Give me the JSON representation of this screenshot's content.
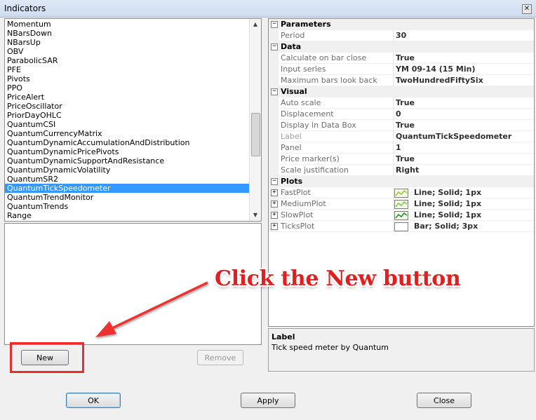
{
  "window": {
    "title": "Indicators",
    "close_glyph": "✕"
  },
  "indicator_list": {
    "items": [
      {
        "label": "Momentum",
        "selected": false
      },
      {
        "label": "NBarsDown",
        "selected": false
      },
      {
        "label": "NBarsUp",
        "selected": false
      },
      {
        "label": "OBV",
        "selected": false
      },
      {
        "label": "ParabolicSAR",
        "selected": false
      },
      {
        "label": "PFE",
        "selected": false
      },
      {
        "label": "Pivots",
        "selected": false
      },
      {
        "label": "PPO",
        "selected": false
      },
      {
        "label": "PriceAlert",
        "selected": false
      },
      {
        "label": "PriceOscillator",
        "selected": false
      },
      {
        "label": "PriorDayOHLC",
        "selected": false
      },
      {
        "label": "QuantumCSI",
        "selected": false
      },
      {
        "label": "QuantumCurrencyMatrix",
        "selected": false
      },
      {
        "label": "QuantumDynamicAccumulationAndDistribution",
        "selected": false
      },
      {
        "label": "QuantumDynamicPricePivots",
        "selected": false
      },
      {
        "label": "QuantumDynamicSupportAndResistance",
        "selected": false
      },
      {
        "label": "QuantumDynamicVolatility",
        "selected": false
      },
      {
        "label": "QuantumSR2",
        "selected": false
      },
      {
        "label": "QuantumTickSpeedometer",
        "selected": true
      },
      {
        "label": "QuantumTrendMonitor",
        "selected": false
      },
      {
        "label": "QuantumTrends",
        "selected": false
      },
      {
        "label": "Range",
        "selected": false
      }
    ],
    "scroll_up_glyph": "▲",
    "scroll_down_glyph": "▼"
  },
  "buttons": {
    "new": "New",
    "remove": "Remove",
    "ok": "OK",
    "apply": "Apply",
    "close": "Close"
  },
  "properties": {
    "rows": [
      {
        "type": "cat",
        "label": "Parameters",
        "expander": "−"
      },
      {
        "type": "prop",
        "name": "Period",
        "value": "30"
      },
      {
        "type": "cat",
        "label": "Data",
        "expander": "−"
      },
      {
        "type": "prop",
        "name": "Calculate on bar close",
        "value": "True"
      },
      {
        "type": "prop",
        "name": "Input series",
        "value": "YM 09-14 (15 Min)"
      },
      {
        "type": "prop",
        "name": "Maximum bars look back",
        "value": "TwoHundredFiftySix"
      },
      {
        "type": "cat",
        "label": "Visual",
        "expander": "−"
      },
      {
        "type": "prop",
        "name": "Auto scale",
        "value": "True"
      },
      {
        "type": "prop",
        "name": "Displacement",
        "value": "0"
      },
      {
        "type": "prop",
        "name": "Display in Data Box",
        "value": "True"
      },
      {
        "type": "prop",
        "name": "Label",
        "value": "QuantumTickSpeedometer",
        "dim": true
      },
      {
        "type": "prop",
        "name": "Panel",
        "value": "1"
      },
      {
        "type": "prop",
        "name": "Price marker(s)",
        "value": "True"
      },
      {
        "type": "prop",
        "name": "Scale justification",
        "value": "Right"
      },
      {
        "type": "cat",
        "label": "Plots",
        "expander": "−"
      },
      {
        "type": "plot",
        "name": "FastPlot",
        "value": "Line; Solid; 1px",
        "expander": "+",
        "swatch": "line",
        "color": "#9acd32"
      },
      {
        "type": "plot",
        "name": "MediumPlot",
        "value": "Line; Solid; 1px",
        "expander": "+",
        "swatch": "line",
        "color": "#7ec850"
      },
      {
        "type": "plot",
        "name": "SlowPlot",
        "value": "Line; Solid; 1px",
        "expander": "+",
        "swatch": "line",
        "color": "#2e8b2e"
      },
      {
        "type": "plot",
        "name": "TicksPlot",
        "value": "Bar; Solid; 3px",
        "expander": "+",
        "swatch": "empty",
        "color": "#ffffff"
      }
    ]
  },
  "help": {
    "title": "Label",
    "text": "Tick speed meter by Quantum"
  },
  "annotation": {
    "text": "Click the New button",
    "color": "#e02020"
  }
}
